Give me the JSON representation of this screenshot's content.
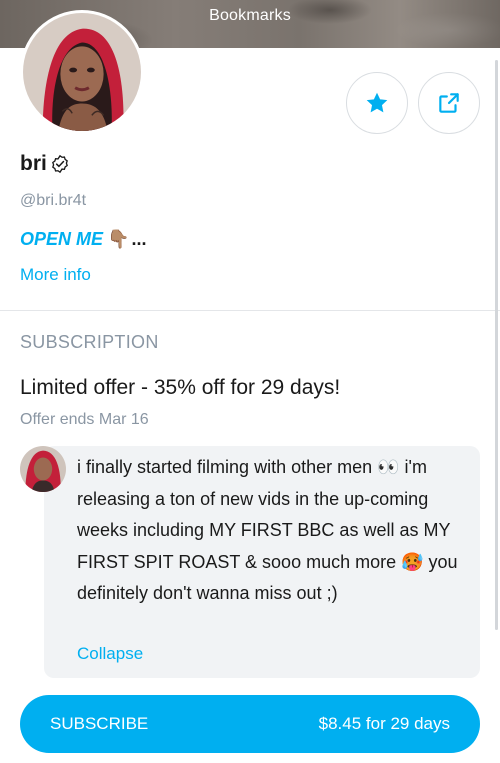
{
  "header": {
    "title": "Bookmarks"
  },
  "profile": {
    "name": "bri",
    "handle": "@bri.br4t",
    "bio_text": "OPEN ME",
    "bio_emoji": "👇🏽",
    "bio_ellipsis": "...",
    "more_info_label": "More info",
    "verified_icon": "verified-badge-icon",
    "star_icon": "star-icon",
    "share_icon": "share-icon"
  },
  "subscription": {
    "section_label": "SUBSCRIPTION",
    "offer_title": "Limited offer - 35% off for 29 days!",
    "offer_ends": "Offer ends Mar 16",
    "message": "i finally started filming with other men 👀 i'm releasing a ton of new vids in the up-coming weeks including MY FIRST BBC as well as MY FIRST SPIT ROAST & sooo much more 🥵 you definitely don't wanna miss out ;)",
    "collapse_label": "Collapse",
    "subscribe_label": "SUBSCRIBE",
    "price_label": "$8.45 for 29 days"
  },
  "colors": {
    "accent": "#00aff0",
    "muted_text": "#8a96a3",
    "bubble_bg": "#f1f3f5",
    "divider": "#e4e6e9"
  }
}
